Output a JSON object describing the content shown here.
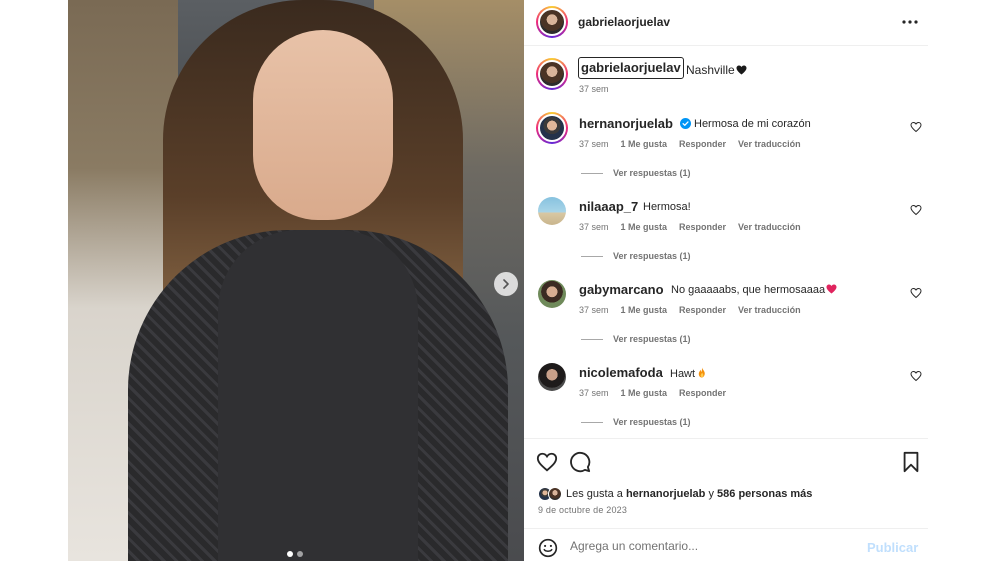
{
  "post": {
    "username": "gabrielaorjuelav",
    "caption_user": "gabrielaorjuelav",
    "caption_text": "Nashville",
    "caption_emoji": "black-heart",
    "caption_time": "37 sem"
  },
  "comments": [
    {
      "username": "hernanorjuelab",
      "verified": true,
      "text": "Hermosa de mi corazón",
      "emoji": "",
      "time": "37 sem",
      "likes": "1 Me gusta",
      "reply": "Responder",
      "translate": "Ver traducción",
      "replies": "Ver respuestas (1)"
    },
    {
      "username": "nilaaap_7",
      "verified": false,
      "text": "Hermosa!",
      "emoji": "",
      "time": "37 sem",
      "likes": "1 Me gusta",
      "reply": "Responder",
      "translate": "Ver traducción",
      "replies": "Ver respuestas (1)"
    },
    {
      "username": "gabymarcano",
      "verified": false,
      "text": "No gaaaaabs, que hermosaaaa",
      "emoji": "red-heart",
      "time": "37 sem",
      "likes": "1 Me gusta",
      "reply": "Responder",
      "translate": "Ver traducción",
      "replies": "Ver respuestas (1)"
    },
    {
      "username": "nicolemafoda",
      "verified": false,
      "text": "Hawt",
      "emoji": "fire",
      "time": "37 sem",
      "likes": "1 Me gusta",
      "reply": "Responder",
      "translate": "",
      "replies": "Ver respuestas (1)"
    }
  ],
  "engagement": {
    "likes_prefix": "Les gusta a",
    "likes_user": "hernanorjuelab",
    "likes_join": "y",
    "likes_others": "586 personas más",
    "date": "9 de octubre de 2023"
  },
  "composer": {
    "placeholder": "Agrega un comentario...",
    "publish_label": "Publicar"
  },
  "carousel": {
    "current": 1,
    "total": 2
  },
  "icons": {
    "more": "more-horizontal-icon",
    "like": "heart-outline-icon",
    "comment": "comment-bubble-icon",
    "save": "bookmark-icon",
    "emoji": "emoji-smile-icon",
    "next": "chevron-right-icon",
    "verified": "verified-badge-icon"
  },
  "colors": {
    "text": "#262626",
    "muted": "#737373",
    "verified": "#0095f6",
    "publish_disabled": "#c0dffd",
    "divider": "#efefef"
  }
}
